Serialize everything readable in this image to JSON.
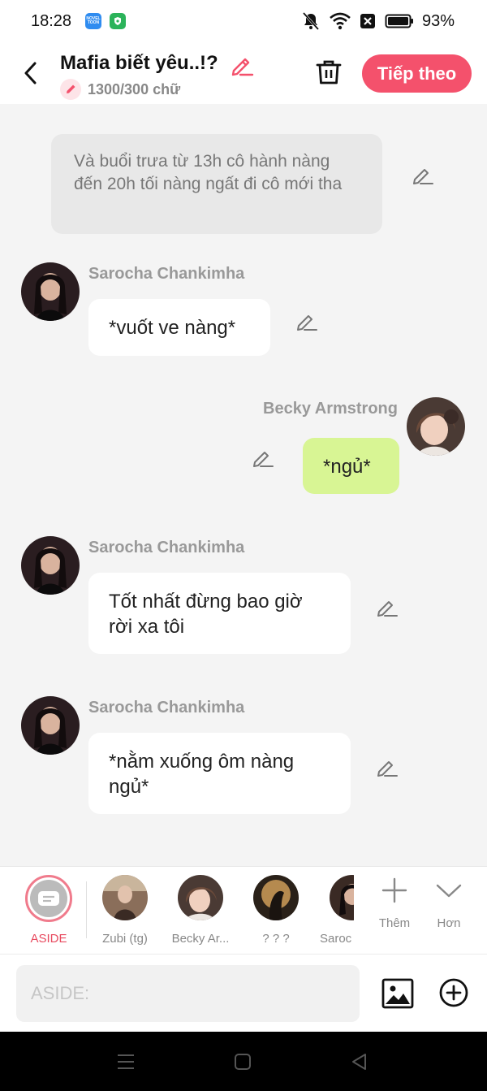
{
  "status": {
    "time": "18:28",
    "battery": "93%",
    "novel_badge": "NOVEL TOON"
  },
  "header": {
    "title": "Mafia biết yêu..!?",
    "word_count": "1300/300 chữ",
    "next_label": "Tiếp theo",
    "accent": "#f4516c"
  },
  "messages": [
    {
      "type": "aside",
      "text": "Và buổi trưa từ 13h cô hành nàng đến 20h tối nàng ngất đi cô mới tha"
    },
    {
      "type": "left",
      "sender": "Sarocha Chankimha",
      "text": "*vuốt ve nàng*"
    },
    {
      "type": "right",
      "sender": "Becky Armstrong",
      "text": "*ngủ*"
    },
    {
      "type": "left",
      "sender": "Sarocha Chankimha",
      "text": "Tốt nhất đừng bao giờ rời xa tôi"
    },
    {
      "type": "left",
      "sender": "Sarocha Chankimha",
      "text": "*nằm xuống ôm nàng ngủ*"
    }
  ],
  "characters": [
    {
      "label": "ASIDE",
      "active": true
    },
    {
      "label": "Zubi (tg)"
    },
    {
      "label": "Becky Ar..."
    },
    {
      "label": "? ? ?"
    },
    {
      "label": "Saroc"
    }
  ],
  "tools": {
    "add_label": "Thêm",
    "more_label": "Hơn"
  },
  "input": {
    "placeholder": "ASIDE:"
  }
}
